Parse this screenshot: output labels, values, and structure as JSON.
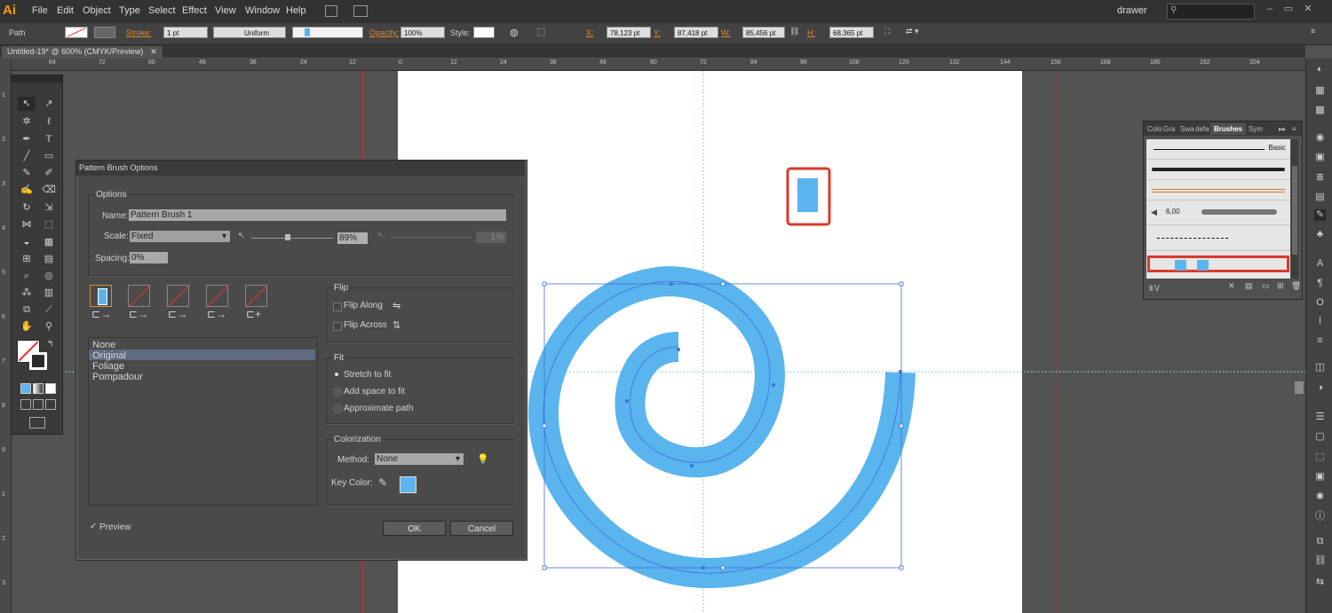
{
  "app": {
    "logo": "Ai",
    "workspace": "drawer"
  },
  "menu": [
    "File",
    "Edit",
    "Object",
    "Type",
    "Select",
    "Effect",
    "View",
    "Window",
    "Help"
  ],
  "controlbar": {
    "object_type": "Path",
    "stroke_label": "Stroke:",
    "stroke_value": "1 pt",
    "profile": "Uniform",
    "opacity_label": "Opacity:",
    "opacity_value": "100%",
    "style_label": "Style:",
    "x_label": "X:",
    "x_value": "78,123 pt",
    "y_label": "Y:",
    "y_value": "87,418 pt",
    "w_label": "W:",
    "w_value": "85,456 pt",
    "h_label": "H:",
    "h_value": "68,365 pt"
  },
  "document": {
    "tab": "Untitled-19* @ 600% (CMYK/Preview)"
  },
  "ruler_h": [
    "84",
    "72",
    "60",
    "48",
    "36",
    "24",
    "12",
    "0",
    "12",
    "24",
    "36",
    "48",
    "60",
    "72",
    "84",
    "96",
    "108",
    "120",
    "132",
    "144",
    "156",
    "168",
    "180",
    "192",
    "204"
  ],
  "ruler_v": [
    "1",
    "2",
    "3",
    "4",
    "5",
    "6",
    "7",
    "8",
    "9",
    "1",
    "2",
    "3",
    "4",
    "5"
  ],
  "dialog": {
    "title": "Pattern Brush Options",
    "options_legend": "Options",
    "name_label": "Name:",
    "name_value": "Pattern Brush 1",
    "scale_label": "Scale:",
    "scale_mode": "Fixed",
    "scale_value": "89%",
    "scale_value2": "1%",
    "spacing_label": "Spacing:",
    "spacing_value": "0%",
    "tile_list": [
      "None",
      "Original",
      "Foliage",
      "Pompadour"
    ],
    "tile_selected": "Original",
    "flip_legend": "Flip",
    "flip_along": "Flip Along",
    "flip_across": "Flip Across",
    "fit_legend": "Fit",
    "fit_options": [
      "Stretch to fit",
      "Add space to fit",
      "Approximate path"
    ],
    "fit_selected": "Stretch to fit",
    "colorization_legend": "Colorization",
    "method_label": "Method:",
    "method_value": "None",
    "key_color_label": "Key Color:",
    "key_color": "#5ab4ee",
    "preview_label": "Preview",
    "ok": "OK",
    "cancel": "Cancel"
  },
  "brushes_panel": {
    "tabs": [
      "Colo",
      "Gra",
      "Swa",
      "defa",
      "Brushes",
      "Sym"
    ],
    "active_tab": "Brushes",
    "basic_label": "Basic",
    "size_label": "6,00"
  },
  "colors": {
    "accent_blue": "#5ab4ee",
    "highlight_red": "#d93a2b",
    "guide_red": "#cc2b2b"
  }
}
